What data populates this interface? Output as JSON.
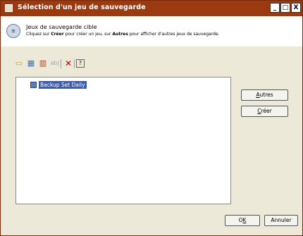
{
  "window": {
    "title": "Sélection d'un jeu de sauvegarde",
    "minimize": "_",
    "maximize": "□",
    "close": "X"
  },
  "header": {
    "title": "Jeux de sauvegarde cible",
    "subtitle_pre": "Cliquez sur ",
    "subtitle_bold1": "Créer",
    "subtitle_mid": " pour créer un jeu, sur ",
    "subtitle_bold2": "Autres",
    "subtitle_post": " pour afficher d'autres jeux de sauvegarde."
  },
  "toolbar": {
    "rename_label": "ab|",
    "delete_label": "✕",
    "help_label": "?"
  },
  "list": {
    "items": [
      {
        "label": "Backup Set Daily",
        "selected": true
      }
    ]
  },
  "buttons": {
    "autres_u": "A",
    "autres_rest": "utres",
    "creer_u": "C",
    "creer_rest": "réer",
    "ok_pre": "O",
    "ok_u": "K",
    "annuler": "Annuler"
  }
}
